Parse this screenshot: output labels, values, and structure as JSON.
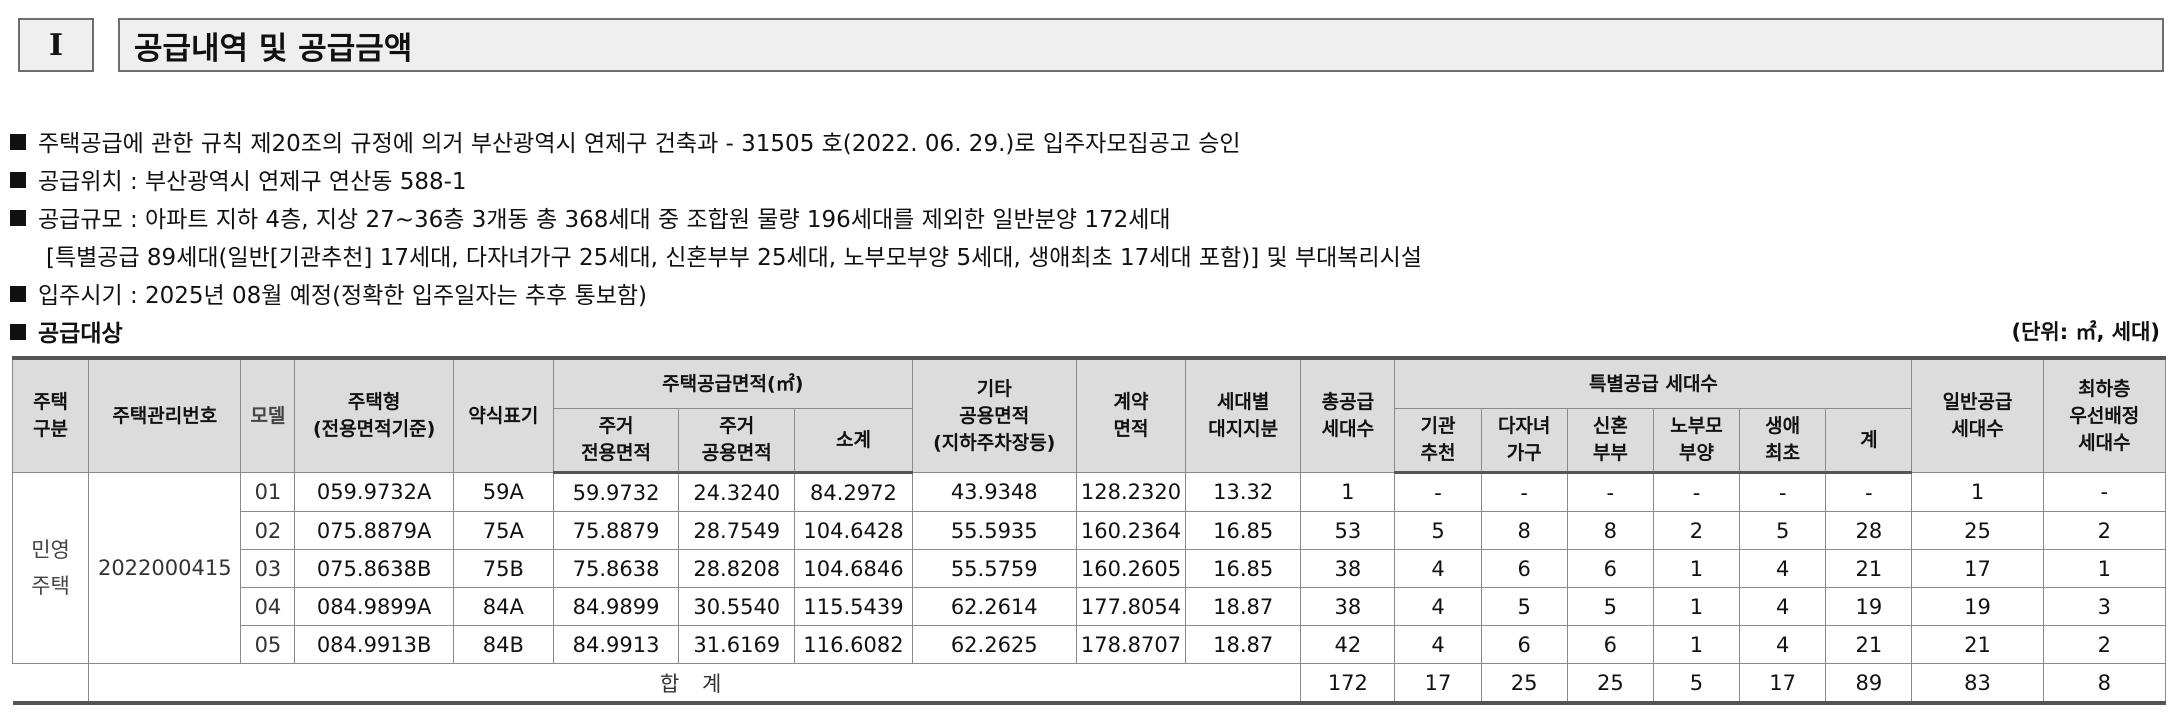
{
  "header": {
    "section_number": "I",
    "title": "공급내역 및 공급금액"
  },
  "paragraphs": [
    "주택공급에 관한 규칙 제20조의 규정에 의거 부산광역시 연제구 건축과 - 31505 호(2022. 06. 29.)로 입주자모집공고 승인",
    "공급위치 : 부산광역시 연제구 연산동 588-1",
    "공급규모 : 아파트 지하 4층, 지상 27~36층 3개동 총 368세대 중 조합원 물량 196세대를 제외한 일반분양 172세대",
    "[특별공급 89세대(일반[기관추천] 17세대, 다자녀가구 25세대, 신혼부부 25세대, 노부모부양 5세대, 생애최초 17세대 포함)] 및 부대복리시설",
    "입주시기 : 2025년 08월 예정(정확한 입주일자는 추후 통보함)",
    "공급대상"
  ],
  "unit_note": "(단위: ㎡, 세대)",
  "table": {
    "headers": {
      "housing_type": [
        "주택",
        "구분"
      ],
      "mgmt_no": "주택관리번호",
      "model": "모델",
      "unit_type": [
        "주택형",
        "(전용면적기준)"
      ],
      "short": "약식표기",
      "supply_area": "주택공급면적(㎡)",
      "excl_area": [
        "주거",
        "전용면적"
      ],
      "common_area": [
        "주거",
        "공용면적"
      ],
      "subtotal": "소계",
      "other_area": [
        "기타",
        "공용면적",
        "(지하주차장등)"
      ],
      "contract_area": [
        "계약",
        "면적"
      ],
      "land_share": [
        "세대별",
        "대지지분"
      ],
      "total_units": [
        "총공급",
        "세대수"
      ],
      "special": "특별공급 세대수",
      "sp_inst": [
        "기관",
        "추천"
      ],
      "sp_multi": [
        "다자녀",
        "가구"
      ],
      "sp_newlywed": [
        "신혼",
        "부부"
      ],
      "sp_elder": [
        "노부모",
        "부양"
      ],
      "sp_first": [
        "생애",
        "최초"
      ],
      "sp_sum": "계",
      "general": [
        "일반공급",
        "세대수"
      ],
      "lowest": [
        "최하층",
        "우선배정",
        "세대수"
      ]
    },
    "housing_kind": [
      "민영",
      "주택"
    ],
    "mgmt_number": "2022000415",
    "rows": [
      [
        "01",
        "059.9732A",
        "59A",
        "59.9732",
        "24.3240",
        "84.2972",
        "43.9348",
        "128.2320",
        "13.32",
        "1",
        "-",
        "-",
        "-",
        "-",
        "-",
        "-",
        "1",
        "-"
      ],
      [
        "02",
        "075.8879A",
        "75A",
        "75.8879",
        "28.7549",
        "104.6428",
        "55.5935",
        "160.2364",
        "16.85",
        "53",
        "5",
        "8",
        "8",
        "2",
        "5",
        "28",
        "25",
        "2"
      ],
      [
        "03",
        "075.8638B",
        "75B",
        "75.8638",
        "28.8208",
        "104.6846",
        "55.5759",
        "160.2605",
        "16.85",
        "38",
        "4",
        "6",
        "6",
        "1",
        "4",
        "21",
        "17",
        "1"
      ],
      [
        "04",
        "084.9899A",
        "84A",
        "84.9899",
        "30.5540",
        "115.5439",
        "62.2614",
        "177.8054",
        "18.87",
        "38",
        "4",
        "5",
        "5",
        "1",
        "4",
        "19",
        "19",
        "3"
      ],
      [
        "05",
        "084.9913B",
        "84B",
        "84.9913",
        "31.6169",
        "116.6082",
        "62.2625",
        "178.8707",
        "18.87",
        "42",
        "4",
        "6",
        "6",
        "1",
        "4",
        "21",
        "21",
        "2"
      ]
    ],
    "total_label": "합 계",
    "total_values": [
      "172",
      "17",
      "25",
      "25",
      "5",
      "17",
      "89",
      "83",
      "8"
    ]
  }
}
